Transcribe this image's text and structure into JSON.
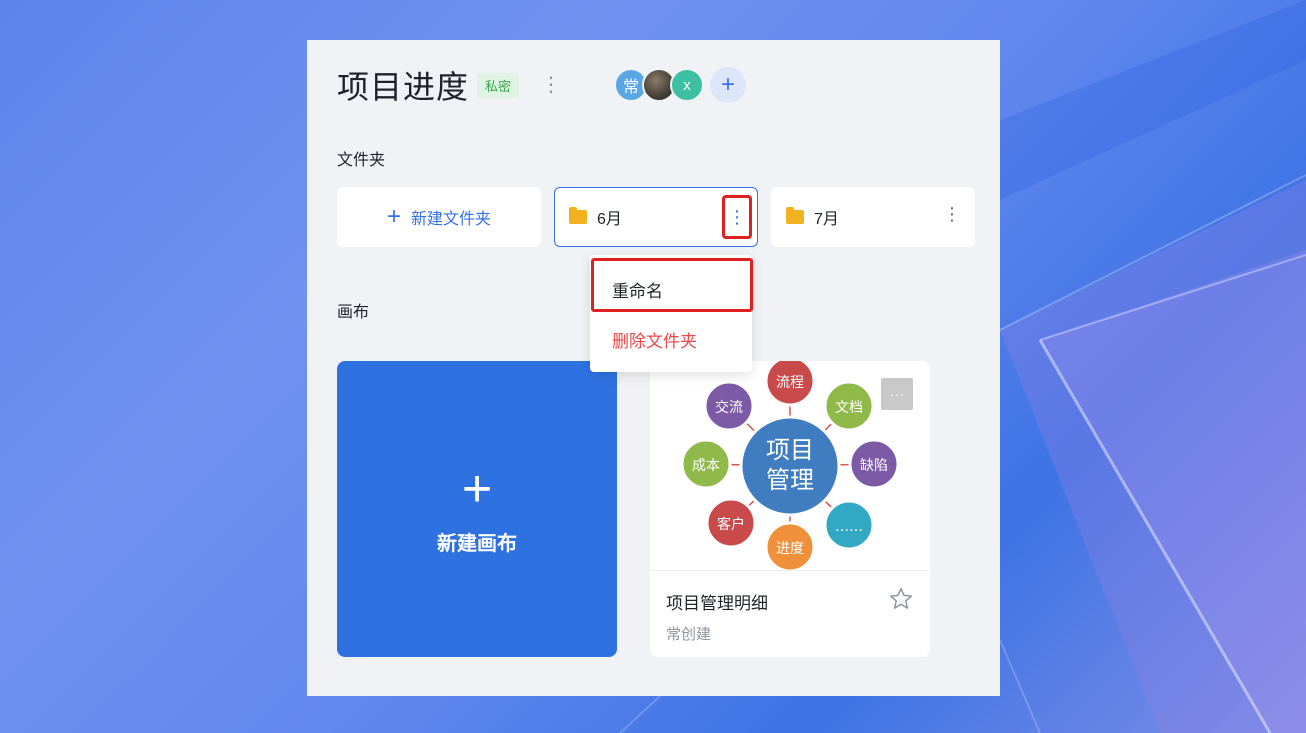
{
  "board": {
    "title": "项目进度",
    "privacy_badge": "私密",
    "more_icon": "⋮",
    "members": [
      {
        "initial": "常",
        "color": "#5aa7e6"
      },
      {
        "initial": "",
        "color": "#5b5246"
      },
      {
        "initial": "x",
        "color": "#3dbfa1"
      }
    ],
    "add_member_icon": "+"
  },
  "folders_section": {
    "label": "文件夹",
    "new_folder_label": "新建文件夹",
    "new_folder_icon": "+",
    "items": [
      {
        "name": "6月",
        "more_icon": "⋮"
      },
      {
        "name": "7月",
        "more_icon": "⋮"
      }
    ]
  },
  "folder_menu": {
    "rename_label": "重命名",
    "delete_label": "删除文件夹"
  },
  "canvas_section": {
    "label": "画布",
    "new_canvas_icon": "+",
    "new_canvas_label": "新建画布",
    "cards": [
      {
        "title": "项目管理明细",
        "creator": "常创建",
        "more_icon": "···",
        "thumbnail": {
          "center": [
            "项目",
            "管理"
          ],
          "nodes": [
            "流程",
            "文档",
            "缺陷",
            "……",
            "进度",
            "客户",
            "成本",
            "交流"
          ]
        }
      }
    ]
  },
  "colors": {
    "accent": "#3571e6",
    "danger": "#f04848",
    "highlight": "#e02020",
    "folder": "#f2b21f"
  }
}
